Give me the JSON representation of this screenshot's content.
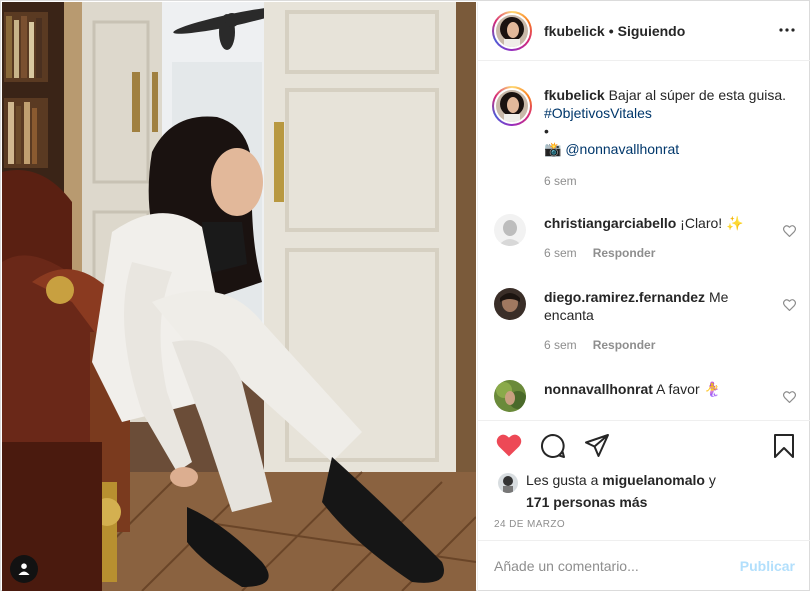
{
  "post": {
    "username": "fkubelick",
    "separator": "•",
    "follow_status": "Siguiendo",
    "more_icon": "more-horizontal-icon"
  },
  "caption": {
    "username": "fkubelick",
    "text": "Bajar al súper de esta guisa.",
    "hashtag": "#ObjetivosVitales",
    "bullet": "•",
    "camera_emoji": "📸",
    "mention": "@nonnavallhonrat",
    "time": "6 sem"
  },
  "comments": [
    {
      "username": "christiangarciabello",
      "text": "¡Claro! ✨",
      "time": "6 sem",
      "reply": "Responder"
    },
    {
      "username": "diego.ramirez.fernandez",
      "text": "Me encanta",
      "time": "6 sem",
      "reply": "Responder"
    },
    {
      "username": "nonnavallhonrat",
      "text": "A favor 🧜‍♀️"
    }
  ],
  "likes": {
    "prefix": "Les gusta a",
    "user": "miguelanomalo",
    "conj": "y",
    "others": "171 personas más"
  },
  "date": "24 DE MARZO",
  "add_comment": {
    "placeholder": "Añade un comentario...",
    "publish": "Publicar"
  },
  "colors": {
    "liked_heart": "#ed4956",
    "link": "#00376b",
    "publish_disabled": "#b2dffc",
    "secondary_text": "#8e8e8e"
  }
}
